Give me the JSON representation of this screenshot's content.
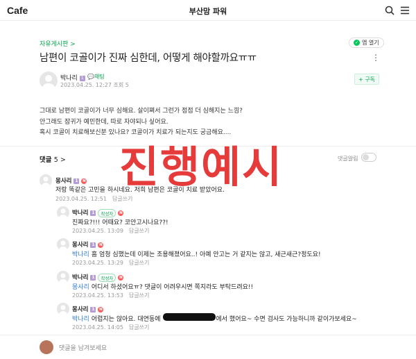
{
  "header": {
    "logo": "Cafe",
    "cafe_name": "부산맘 파워"
  },
  "post": {
    "board": "자유게시판 >",
    "app_open": "앱 열기",
    "title": "남편이 코골이가 진짜 심한데, 어떻게 해야할까요ㅠㅠ",
    "author": "박나리",
    "chat": "채팅",
    "meta": "2023.04.25. 12:27 조회 5",
    "follow": "+ 구독",
    "body": [
      "그대로 남편이 코골이가 너무 심해요. 살이쪄서 그런가 점점 더 심해지는 느낌?",
      "안그래도 잠귀가 예민한데, 따로 자야되나 싶어요.",
      "혹시 코골이 치료해보신분 있나요? 코골이가 치료가 되는지도 궁금해요...."
    ]
  },
  "comments_section": {
    "label": "댓글",
    "count": "5 >",
    "alarm": "댓글알림"
  },
  "comments": [
    {
      "nick": "몽사리",
      "writer": "",
      "mention": "",
      "text": "저랑 똑같은 고민을 하시네요. 저희 남편은 코골이 치료 받았어요.",
      "time": "2023.04.25. 12:51",
      "reply": "답글쓰기"
    },
    {
      "nick": "박나리",
      "writer": "작성자",
      "mention": "",
      "text": "진짜요?!!! 어때요? 코안고시나요??!",
      "time": "2023.04.25. 13:09",
      "reply": "답글쓰기"
    },
    {
      "nick": "몽사리",
      "writer": "",
      "mention": "박나리",
      "text": "흠 엄청 심했는데 이제는 조용해졌어요..! 아예 안고는 거 같지는 않고, 새근새근?정도요!",
      "time": "2023.04.25. 13:29",
      "reply": "답글쓰기"
    },
    {
      "nick": "박나리",
      "writer": "작성자",
      "mention": "몽사리",
      "text": "어디서 하셨어요ㅠ? 댓글이 어려우시면 쪽지라도 부탁드려요!!",
      "time": "2023.04.25. 13:53",
      "reply": "답글쓰기"
    },
    {
      "nick": "몽사리",
      "writer": "",
      "mention": "박나리",
      "text_before": "어렵지는 않아요. 대연동에",
      "text_after": "에서 했어요~ 수면 검사도 가능하니까 같이가보세요~",
      "time": "2023.04.25. 14:05",
      "reply": "답글쓰기"
    }
  ],
  "reply_placeholder": "댓글을 남겨보세요",
  "watermark": "진행예시",
  "icons": [
    "search-icon",
    "menu-icon",
    "more-icon",
    "chat-icon"
  ],
  "colors": {
    "accent": "#03a94d",
    "mention": "#2f7ad8",
    "watermark": "#e53b3b"
  }
}
